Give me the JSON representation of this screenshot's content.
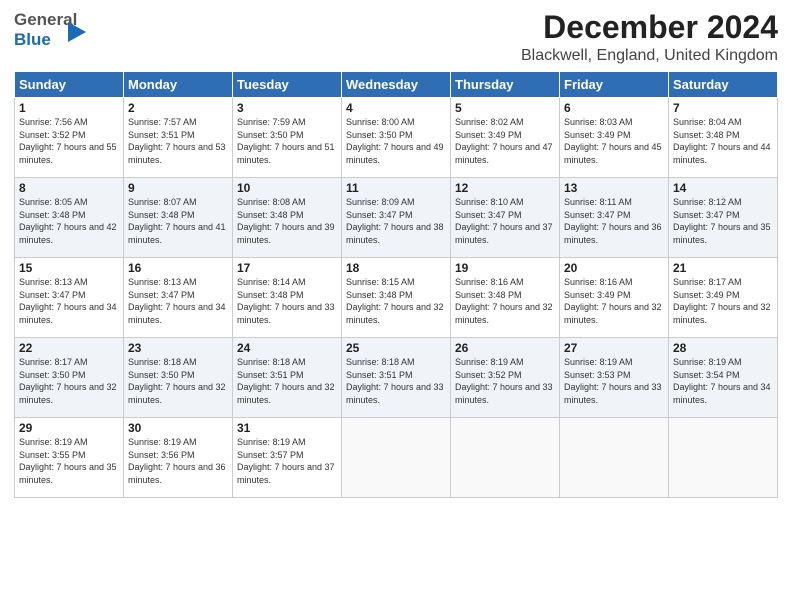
{
  "header": {
    "logo_general": "General",
    "logo_blue": "Blue",
    "title": "December 2024",
    "subtitle": "Blackwell, England, United Kingdom"
  },
  "weekdays": [
    "Sunday",
    "Monday",
    "Tuesday",
    "Wednesday",
    "Thursday",
    "Friday",
    "Saturday"
  ],
  "weeks": [
    [
      {
        "day": "1",
        "sunrise": "7:56 AM",
        "sunset": "3:52 PM",
        "daylight": "7 hours and 55 minutes."
      },
      {
        "day": "2",
        "sunrise": "7:57 AM",
        "sunset": "3:51 PM",
        "daylight": "7 hours and 53 minutes."
      },
      {
        "day": "3",
        "sunrise": "7:59 AM",
        "sunset": "3:50 PM",
        "daylight": "7 hours and 51 minutes."
      },
      {
        "day": "4",
        "sunrise": "8:00 AM",
        "sunset": "3:50 PM",
        "daylight": "7 hours and 49 minutes."
      },
      {
        "day": "5",
        "sunrise": "8:02 AM",
        "sunset": "3:49 PM",
        "daylight": "7 hours and 47 minutes."
      },
      {
        "day": "6",
        "sunrise": "8:03 AM",
        "sunset": "3:49 PM",
        "daylight": "7 hours and 45 minutes."
      },
      {
        "day": "7",
        "sunrise": "8:04 AM",
        "sunset": "3:48 PM",
        "daylight": "7 hours and 44 minutes."
      }
    ],
    [
      {
        "day": "8",
        "sunrise": "8:05 AM",
        "sunset": "3:48 PM",
        "daylight": "7 hours and 42 minutes."
      },
      {
        "day": "9",
        "sunrise": "8:07 AM",
        "sunset": "3:48 PM",
        "daylight": "7 hours and 41 minutes."
      },
      {
        "day": "10",
        "sunrise": "8:08 AM",
        "sunset": "3:48 PM",
        "daylight": "7 hours and 39 minutes."
      },
      {
        "day": "11",
        "sunrise": "8:09 AM",
        "sunset": "3:47 PM",
        "daylight": "7 hours and 38 minutes."
      },
      {
        "day": "12",
        "sunrise": "8:10 AM",
        "sunset": "3:47 PM",
        "daylight": "7 hours and 37 minutes."
      },
      {
        "day": "13",
        "sunrise": "8:11 AM",
        "sunset": "3:47 PM",
        "daylight": "7 hours and 36 minutes."
      },
      {
        "day": "14",
        "sunrise": "8:12 AM",
        "sunset": "3:47 PM",
        "daylight": "7 hours and 35 minutes."
      }
    ],
    [
      {
        "day": "15",
        "sunrise": "8:13 AM",
        "sunset": "3:47 PM",
        "daylight": "7 hours and 34 minutes."
      },
      {
        "day": "16",
        "sunrise": "8:13 AM",
        "sunset": "3:47 PM",
        "daylight": "7 hours and 34 minutes."
      },
      {
        "day": "17",
        "sunrise": "8:14 AM",
        "sunset": "3:48 PM",
        "daylight": "7 hours and 33 minutes."
      },
      {
        "day": "18",
        "sunrise": "8:15 AM",
        "sunset": "3:48 PM",
        "daylight": "7 hours and 32 minutes."
      },
      {
        "day": "19",
        "sunrise": "8:16 AM",
        "sunset": "3:48 PM",
        "daylight": "7 hours and 32 minutes."
      },
      {
        "day": "20",
        "sunrise": "8:16 AM",
        "sunset": "3:49 PM",
        "daylight": "7 hours and 32 minutes."
      },
      {
        "day": "21",
        "sunrise": "8:17 AM",
        "sunset": "3:49 PM",
        "daylight": "7 hours and 32 minutes."
      }
    ],
    [
      {
        "day": "22",
        "sunrise": "8:17 AM",
        "sunset": "3:50 PM",
        "daylight": "7 hours and 32 minutes."
      },
      {
        "day": "23",
        "sunrise": "8:18 AM",
        "sunset": "3:50 PM",
        "daylight": "7 hours and 32 minutes."
      },
      {
        "day": "24",
        "sunrise": "8:18 AM",
        "sunset": "3:51 PM",
        "daylight": "7 hours and 32 minutes."
      },
      {
        "day": "25",
        "sunrise": "8:18 AM",
        "sunset": "3:51 PM",
        "daylight": "7 hours and 33 minutes."
      },
      {
        "day": "26",
        "sunrise": "8:19 AM",
        "sunset": "3:52 PM",
        "daylight": "7 hours and 33 minutes."
      },
      {
        "day": "27",
        "sunrise": "8:19 AM",
        "sunset": "3:53 PM",
        "daylight": "7 hours and 33 minutes."
      },
      {
        "day": "28",
        "sunrise": "8:19 AM",
        "sunset": "3:54 PM",
        "daylight": "7 hours and 34 minutes."
      }
    ],
    [
      {
        "day": "29",
        "sunrise": "8:19 AM",
        "sunset": "3:55 PM",
        "daylight": "7 hours and 35 minutes."
      },
      {
        "day": "30",
        "sunrise": "8:19 AM",
        "sunset": "3:56 PM",
        "daylight": "7 hours and 36 minutes."
      },
      {
        "day": "31",
        "sunrise": "8:19 AM",
        "sunset": "3:57 PM",
        "daylight": "7 hours and 37 minutes."
      },
      null,
      null,
      null,
      null
    ]
  ]
}
